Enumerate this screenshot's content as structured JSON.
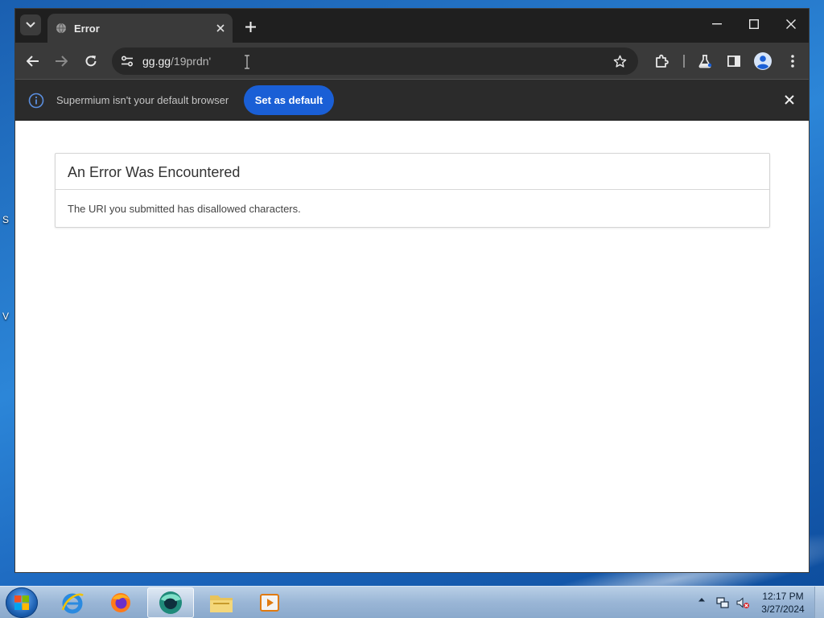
{
  "desktop": {
    "edge_labels": [
      "S",
      "V"
    ]
  },
  "browser": {
    "tab": {
      "title": "Error"
    },
    "address": {
      "host": "gg.gg",
      "path": "/19prdn'"
    },
    "infobar": {
      "message": "Supermium isn't your default browser",
      "button_label": "Set as default"
    }
  },
  "page": {
    "heading": "An Error Was Encountered",
    "message": "The URI you submitted has disallowed characters."
  },
  "taskbar": {
    "apps": [
      "internet-explorer",
      "firefox",
      "supermium",
      "file-explorer",
      "media-player"
    ],
    "clock": {
      "time": "12:17 PM",
      "date": "3/27/2024"
    }
  },
  "colors": {
    "accent_button": "#1a5fd6",
    "chrome_dark": "#1f1f1f",
    "toolbar": "#3a3a3a"
  }
}
